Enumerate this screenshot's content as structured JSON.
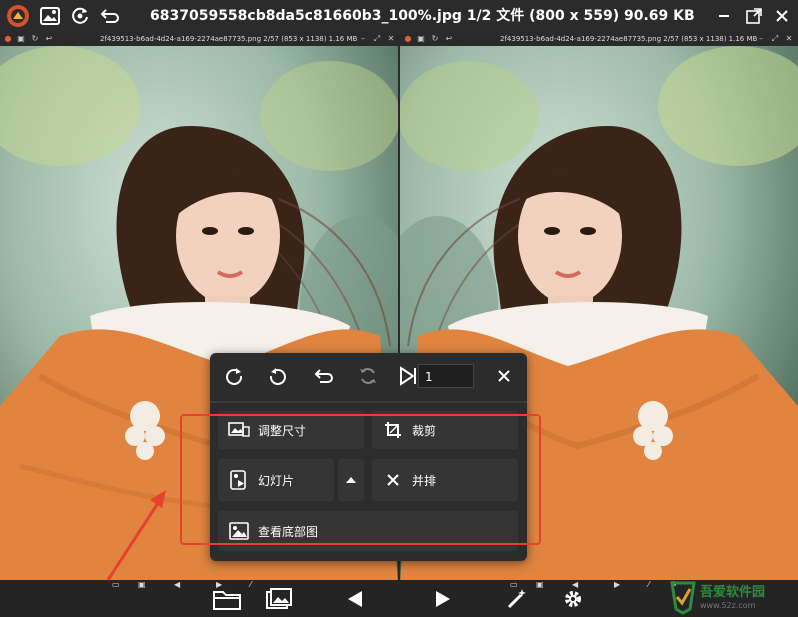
{
  "window": {
    "title": "6837059558cb8da5c81660b3_100%.jpg 1/2 文件 (800 x 559) 90.69 KB"
  },
  "panels": [
    {
      "filename": "2f439513-b6ad-4d24-a169-2274ae87735.png 2/57 (853 x 1138) 1.16 MB"
    },
    {
      "filename": "2f439513-b6ad-4d24-a169-2274ae87735.png 2/57 (853 x 1138) 1.16 MB"
    }
  ],
  "popup": {
    "page_value": "1",
    "resize_label": "调整尺寸",
    "crop_label": "裁剪",
    "slideshow_label": "幻灯片",
    "side_by_side_label": "并排",
    "set_wallpaper_label": "查看底部图"
  },
  "watermark": {
    "text": "吾爱软件园",
    "url": "www.52z.com"
  },
  "colors": {
    "accent_red": "#e8402f",
    "popup_bg": "#2c2c2c",
    "sweater": "#e0843f"
  }
}
